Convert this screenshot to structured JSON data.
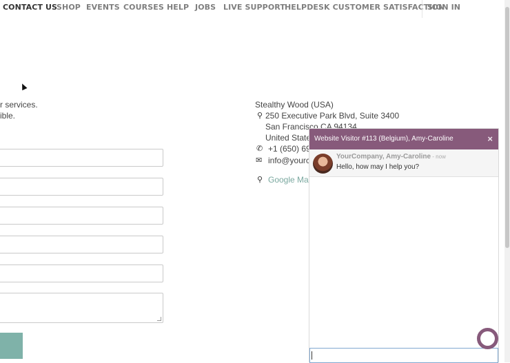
{
  "nav": {
    "items": [
      "CONTACT US",
      "SHOP",
      "EVENTS",
      "COURSES",
      "HELP",
      "JOBS",
      "LIVE SUPPORT",
      "HELPDESK CUSTOMER SATISFACTION",
      "SIGN IN"
    ]
  },
  "intro": {
    "line1": "r services.",
    "line2": "ible."
  },
  "address": {
    "company": "Stealthy Wood (USA)",
    "street": "250 Executive Park Blvd, Suite 3400",
    "city": "San Francisco CA 94134",
    "country": "United State",
    "phone": "+1 (650) 69",
    "email": "info@yourc",
    "map_link": "Google Map"
  },
  "chat": {
    "title": "Website Visitor #113 (Belgium), Amy-Caroline",
    "close": "×",
    "author": "YourCompany, Amy-Caroline",
    "time": " - now",
    "message": "Hello, how may I help you?"
  }
}
